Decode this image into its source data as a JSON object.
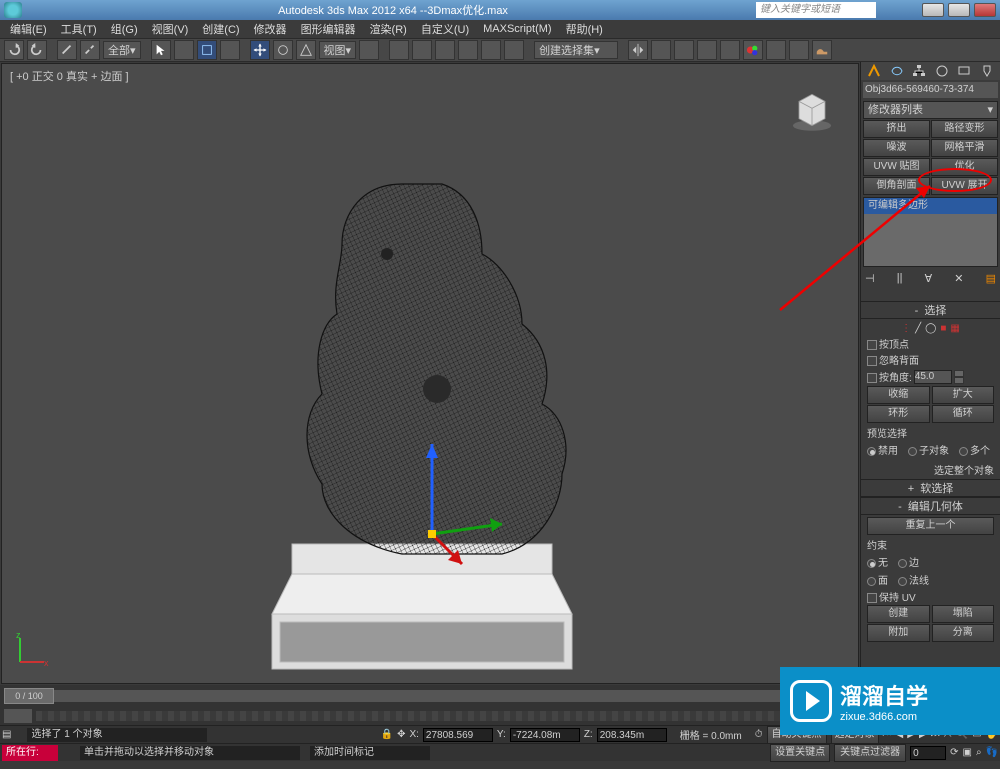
{
  "title": "Autodesk 3ds Max  2012 x64  --3Dmax优化.max",
  "search_placeholder": "键入关键字或短语",
  "menu": [
    "编辑(E)",
    "工具(T)",
    "组(G)",
    "视图(V)",
    "创建(C)",
    "修改器",
    "图形编辑器",
    "渲染(R)",
    "自定义(U)",
    "MAXScript(M)",
    "帮助(H)"
  ],
  "toolbar": {
    "scope": "全部",
    "view_dropdown": "视图",
    "selset_dropdown": "创建选择集"
  },
  "viewport_label": "[ +0 正交 0 真实 + 边面 ]",
  "object_name": "Obj3d66-569460-73-374",
  "modifier_list_placeholder": "修改器列表",
  "mod_buttons": {
    "r1c1": "挤出",
    "r1c2": "路径变形",
    "r2c1": "噪波",
    "r2c2": "网格平滑",
    "r3c1": "UVW 贴图",
    "r3c2": "优化",
    "r4c1": "倒角剖面",
    "r4c2": "UVW 展开"
  },
  "stack_item": "可编辑多边形",
  "rollouts": {
    "selection": {
      "title": "选择",
      "by_vertex": "按顶点",
      "ignore_backfacing": "忽略背面",
      "by_angle": "按角度:",
      "angle_value": "45.0",
      "shrink": "收缩",
      "grow": "扩大",
      "ring": "环形",
      "loop": "循环",
      "preview_label": "预览选择",
      "preview_opts": [
        "禁用",
        "子对象",
        "多个"
      ],
      "select_whole": "选定整个对象"
    },
    "soft_sel": "软选择",
    "edit_geom": {
      "title": "编辑几何体",
      "repeat_last": "重复上一个",
      "constraints_label": "约束",
      "c_none": "无",
      "c_edge": "边",
      "c_face": "面",
      "c_normal": "法线",
      "preserve_uv": "保持 UV",
      "create": "创建",
      "collapse": "塌陷",
      "attach": "附加",
      "detach": "分离"
    }
  },
  "timeline": {
    "frame_display": "0 / 100",
    "start": 0,
    "end": 100
  },
  "status": {
    "line1_text": "选择了 1 个对象",
    "x": "27808.569",
    "y": "-7224.08m",
    "z": "208.345m",
    "grid": "栅格 = 0.0mm",
    "autokey": "自动关键点",
    "selected": "选定对象",
    "line2_text_left": "单击并拖动以选择并移动对象",
    "line2_text_mid": "添加时间标记",
    "setkey": "设置关键点",
    "keyfilter": "关键点过滤器"
  },
  "bottom_left": {
    "field": "所在行:"
  },
  "watermark": {
    "brand": "溜溜自学",
    "domain": "zixue.3d66.com"
  }
}
